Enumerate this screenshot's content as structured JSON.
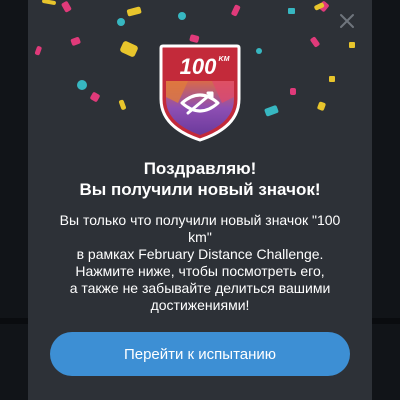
{
  "badge": {
    "label": "100",
    "unit": "KM"
  },
  "dialog": {
    "title_line1": "Поздравляю!",
    "title_line2": "Вы получили новый значок!",
    "body_lines": [
      "Вы только что получили новый значок \"100",
      "km\"",
      "в рамках February Distance Challenge.",
      "Нажмите ниже, чтобы посмотреть его,",
      "а также не забывайте делиться вашими",
      "достижениями!"
    ],
    "button_label": "Перейти к испытанию",
    "close_icon": "close-icon"
  },
  "colors": {
    "dialog_bg": "#2d3137",
    "button": "#3d8fd4",
    "badge_red": "#c32a3a",
    "confetti": [
      "#e8c52c",
      "#e03a7a",
      "#37b7c1"
    ]
  }
}
